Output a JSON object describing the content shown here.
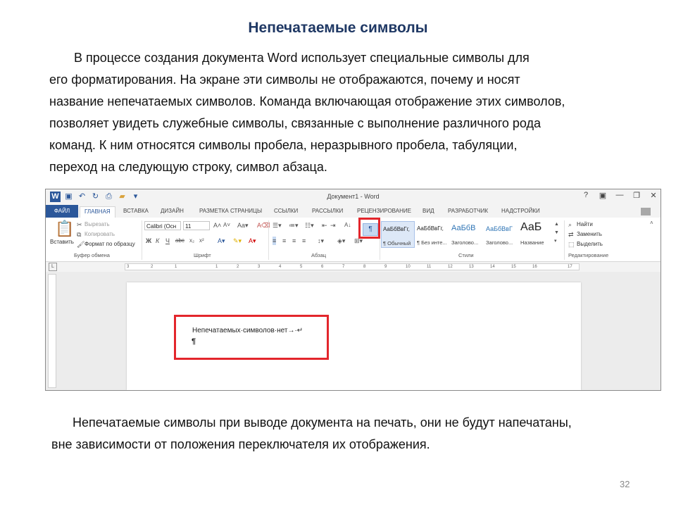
{
  "slide": {
    "title": "Непечатаемые символы",
    "paragraph1": [
      "В процессе создания документа Word использует специальные символы для",
      "его форматирования. На экране эти символы не отображаются, почему и носят",
      "название непечатаемых символов. Команда включающая отображение этих символов,",
      "позволяет увидеть служебные символы, связанные с выполнение различного рода",
      " команд. К ним относятся символы пробела, неразрывного пробела, табуляции,",
      "переход на следующую строку, символ абзаца."
    ],
    "paragraph2": [
      "Непечатаемые символы при выводе документа на печать, они не будут напечатаны,",
      "вне зависимости от положения переключателя их отображения."
    ],
    "page_number": "32"
  },
  "word": {
    "window_title": "Документ1 - Word",
    "window_controls": [
      "?",
      "▣",
      "—",
      "❐",
      "✕"
    ],
    "tabs": [
      "ФАЙЛ",
      "ГЛАВНАЯ",
      "ВСТАВКА",
      "ДИЗАЙН",
      "РАЗМЕТКА СТРАНИЦЫ",
      "ССЫЛКИ",
      "РАССЫЛКИ",
      "РЕЦЕНЗИРОВАНИЕ",
      "ВИД",
      "РАЗРАБОТЧИК",
      "НАДСТРОЙКИ"
    ],
    "clipboard": {
      "paste": "Вставить",
      "cut": "Вырезать",
      "copy": "Копировать",
      "format_painter": "Формат по образцу",
      "label": "Буфер обмена"
    },
    "font": {
      "name": "Calibri (Осн",
      "size": "11",
      "label": "Шрифт"
    },
    "paragraph_group": {
      "pilcrow": "¶",
      "label": "Абзац"
    },
    "styles": {
      "items": [
        {
          "sample": "АаБбВвГг,",
          "name": "¶ Обычный"
        },
        {
          "sample": "АаБбВвГг,",
          "name": "¶ Без инте..."
        },
        {
          "sample": "АаБбВ",
          "name": "Заголово..."
        },
        {
          "sample": "АаБбВвГ",
          "name": "Заголово..."
        },
        {
          "sample": "АаБ",
          "name": "Название"
        }
      ],
      "label": "Стили"
    },
    "editing": {
      "find": "Найти",
      "replace": "Заменить",
      "select": "Выделить",
      "label": "Редактирование"
    },
    "ruler_marks": [
      "3",
      "2",
      "1",
      "1",
      "2",
      "3",
      "4",
      "5",
      "6",
      "7",
      "8",
      "9",
      "10",
      "11",
      "12",
      "13",
      "14",
      "15",
      "16",
      "17"
    ],
    "document": {
      "line1": "Непечатаемых·символов·нет→·↵",
      "line2": "¶"
    }
  }
}
